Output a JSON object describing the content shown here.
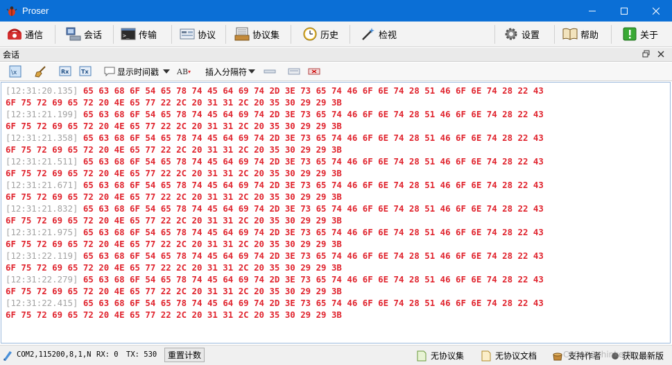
{
  "window": {
    "title": "Proser"
  },
  "toolbar": {
    "items": [
      {
        "label": "通信",
        "icon": "phone-icon"
      },
      {
        "label": "会话",
        "icon": "computer-icon"
      },
      {
        "label": "传输",
        "icon": "terminal-icon"
      },
      {
        "label": "协议",
        "icon": "protocol-icon"
      },
      {
        "label": "协议集",
        "icon": "protocol-set-icon"
      },
      {
        "label": "历史",
        "icon": "clock-icon"
      },
      {
        "label": "检视",
        "icon": "magic-wand-icon"
      },
      {
        "label": "设置",
        "icon": "gear-icon"
      },
      {
        "label": "帮助",
        "icon": "book-icon"
      },
      {
        "label": "关于",
        "icon": "info-icon"
      }
    ]
  },
  "panel": {
    "title": "会话"
  },
  "session_toolbar": {
    "show_timestamp_label": "显示时间戳",
    "insert_separator_label": "插入分隔符",
    "ab_label": "AB",
    "rx_label": "Rx",
    "tx_label": "Tx"
  },
  "log": {
    "entries": [
      {
        "time": "[12:31:20.135]"
      },
      {
        "time": "[12:31:21.199]"
      },
      {
        "time": "[12:31:21.358]"
      },
      {
        "time": "[12:31:21.511]"
      },
      {
        "time": "[12:31:21.671]"
      },
      {
        "time": "[12:31:21.832]"
      },
      {
        "time": "[12:31:21.975]"
      },
      {
        "time": "[12:31:22.119]"
      },
      {
        "time": "[12:31:22.279]"
      },
      {
        "time": "[12:31:22.415]"
      }
    ],
    "hex_line1": "65 63 68 6F 54 65 78 74 45 64 69 74 2D 3E 73 65 74 46 6F 6E 74 28 51 46 6F 6E 74 28 22 43",
    "hex_line2": "6F 75 72 69 65 72 20 4E 65 77 22 2C 20 31 31 2C 20 35 30 29 29 3B"
  },
  "status": {
    "port": "COM2,115200,8,1,N",
    "rx": "RX: 0",
    "tx": "TX: 530",
    "reset_label": "重置计数",
    "no_protocol_set": "无协议集",
    "no_protocol_doc": "无协议文档",
    "support_author": "支持作者",
    "get_latest": "获取最新版",
    "watermark": "CSDN @thinkerliu"
  },
  "colors": {
    "titlebar": "#0b6fd6",
    "hex": "#e0232d",
    "timestamp": "#a3a3a3"
  }
}
